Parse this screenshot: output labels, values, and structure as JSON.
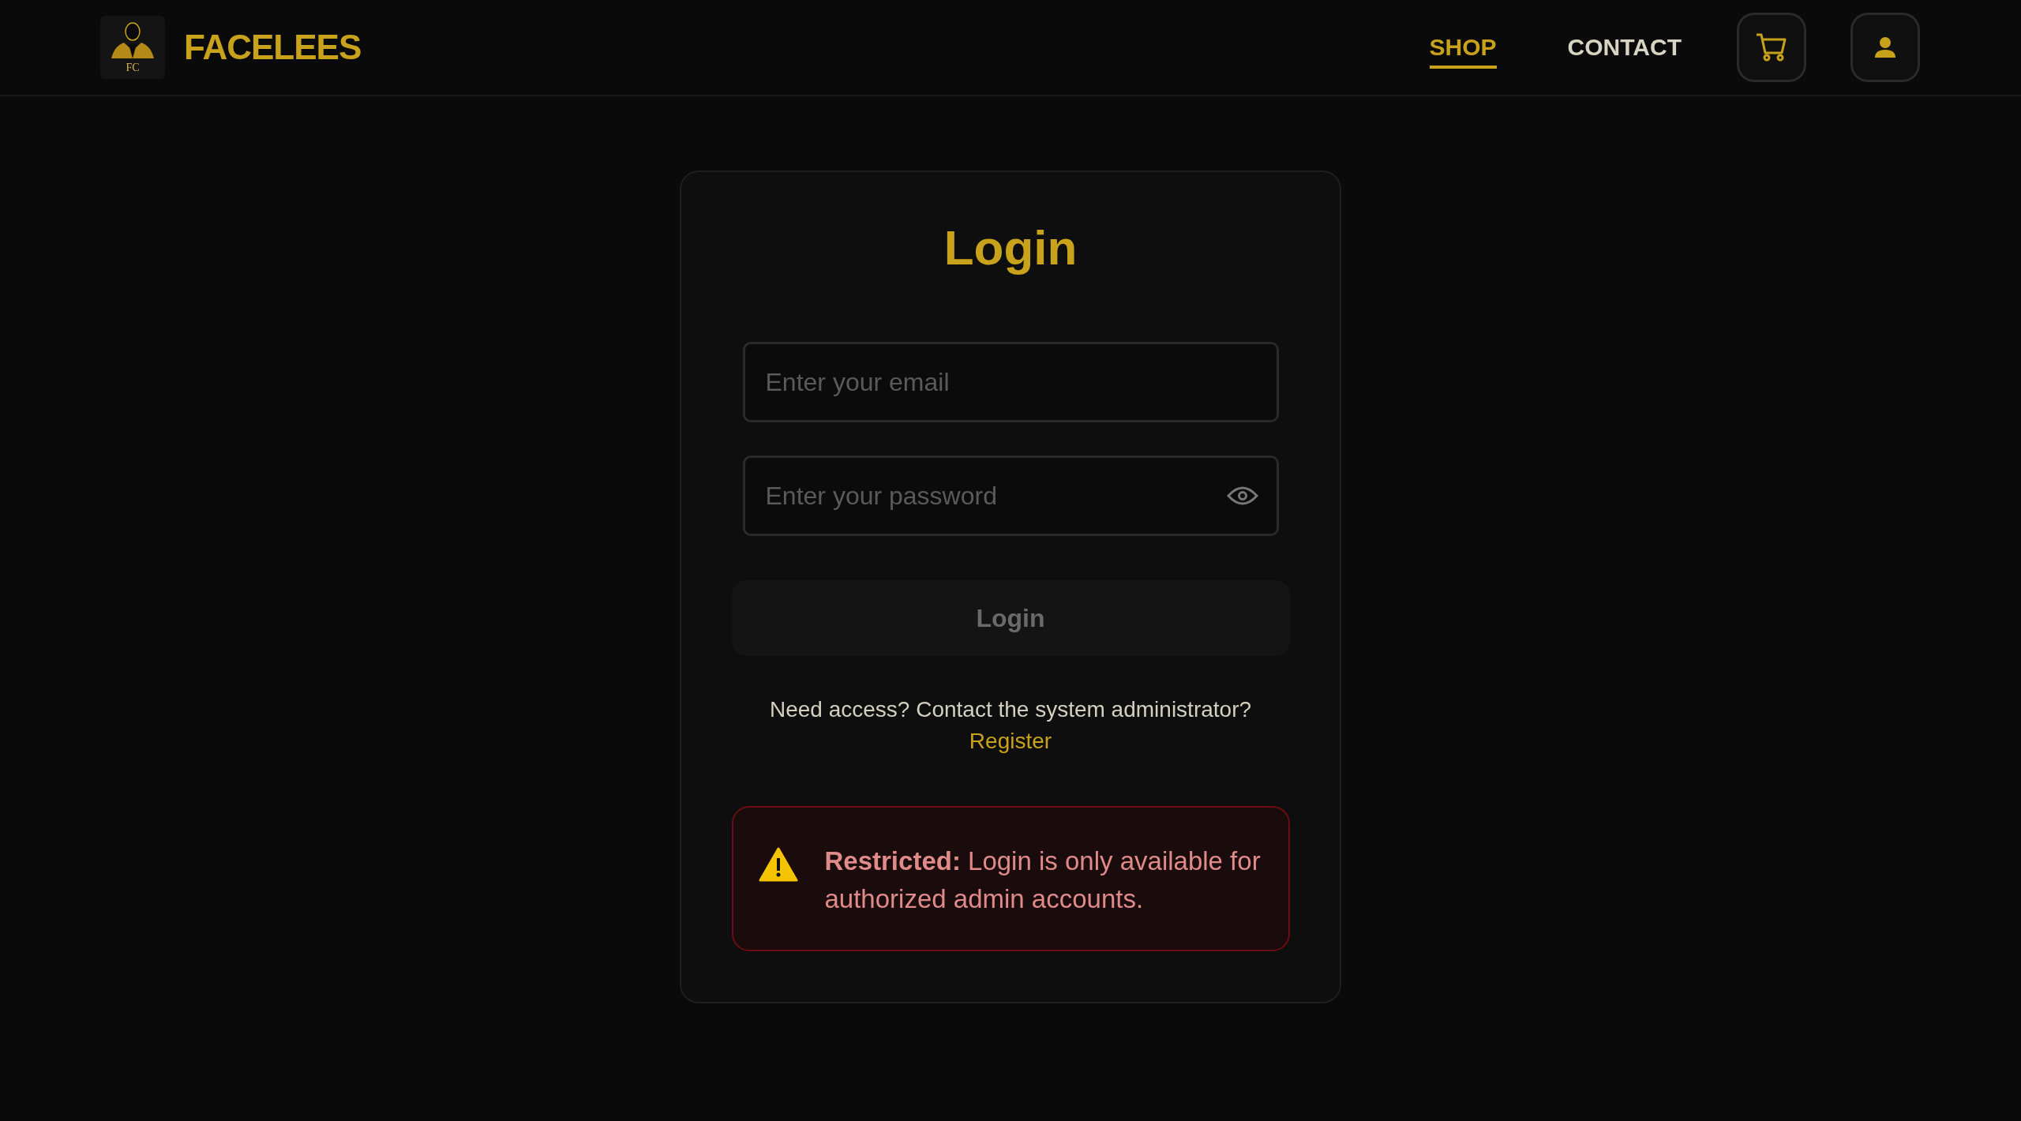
{
  "header": {
    "logo_monogram": "FC",
    "brand": "FACELEES",
    "nav": [
      {
        "label": "SHOP",
        "selected": true
      },
      {
        "label": "CONTACT",
        "selected": false
      }
    ]
  },
  "login": {
    "title": "Login",
    "email": {
      "placeholder": "Enter your email"
    },
    "password": {
      "placeholder": "Enter your password"
    },
    "submit": {
      "label": "Login",
      "disabled": true
    },
    "help_text": "Need access? Contact the system administrator?",
    "register_link": "Register",
    "alert": {
      "text": "**Restricted:** Login is only available for authorized admin accounts."
    }
  }
}
